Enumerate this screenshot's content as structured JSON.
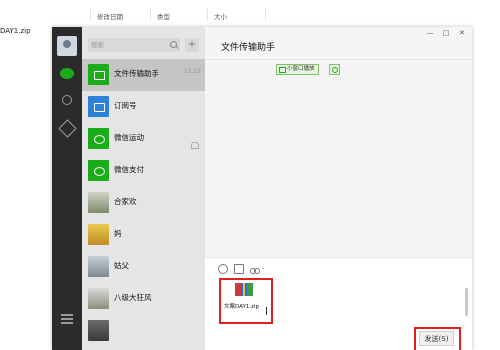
{
  "explorer": {
    "columns": [
      "修改日期",
      "类型",
      "大小"
    ],
    "file_name": "DAY1.zip"
  },
  "wechat": {
    "search_placeholder": "搜索",
    "add_label": "+",
    "chats": [
      {
        "name": "文件传输助手",
        "time": "12:23"
      },
      {
        "name": "订阅号",
        "time": ""
      },
      {
        "name": "微信运动",
        "time": ""
      },
      {
        "name": "微信支付",
        "time": ""
      },
      {
        "name": "合家欢",
        "time": ""
      },
      {
        "name": "妈",
        "time": ""
      },
      {
        "name": "姑父",
        "time": ""
      },
      {
        "name": "八级大狂风",
        "time": ""
      }
    ],
    "chat_title": "文件传输助手",
    "window_buttons": [
      "—",
      "□",
      "✕"
    ],
    "mini_window_label": "小窗口播放",
    "attachment_name": "文案DAY1.zip",
    "send_label": "发送(S)",
    "scissors_dropdown": "⌄"
  },
  "icons": [
    "chat-icon",
    "contacts-icon",
    "favorites-icon",
    "menu-icon",
    "search-icon",
    "emoji-icon",
    "folder-icon",
    "scissors-icon",
    "zip-icon"
  ],
  "colors": {
    "accent_green": "#1aad19",
    "highlight_red": "#e02020",
    "nav_dark": "#2b2b2b"
  }
}
